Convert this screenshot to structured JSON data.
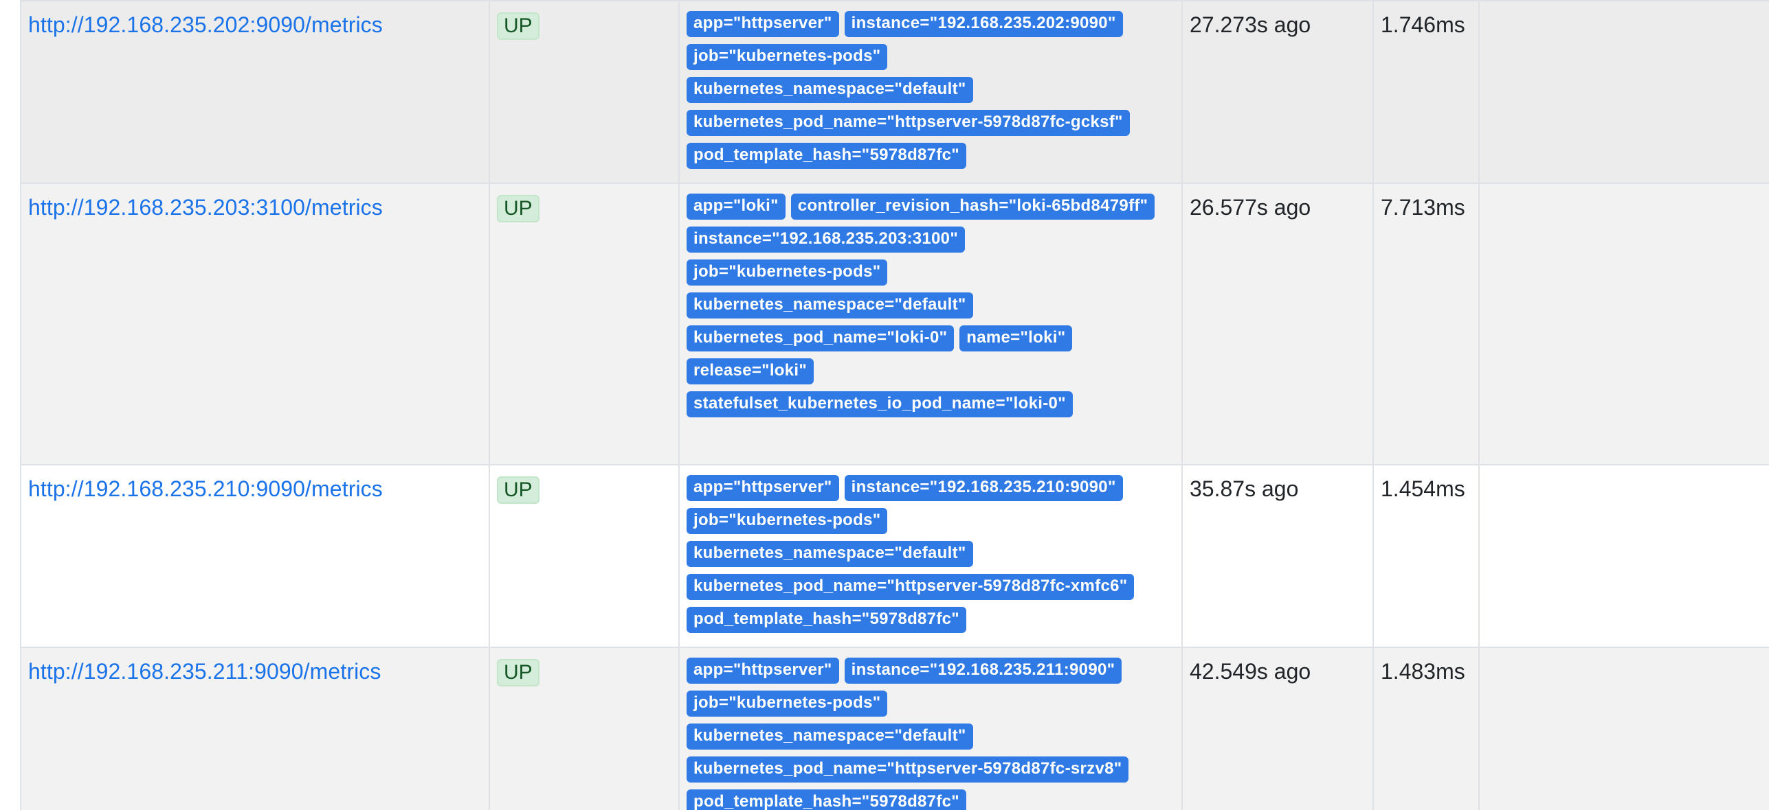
{
  "targets": [
    {
      "endpoint": "http://192.168.235.202:9090/metrics",
      "state": "UP",
      "labels": [
        "app=\"httpserver\"",
        "instance=\"192.168.235.202:9090\"",
        "job=\"kubernetes-pods\"",
        "kubernetes_namespace=\"default\"",
        "kubernetes_pod_name=\"httpserver-5978d87fc-gcksf\"",
        "pod_template_hash=\"5978d87fc\""
      ],
      "last_scrape": "27.273s ago",
      "scrape_duration": "1.746ms",
      "error": ""
    },
    {
      "endpoint": "http://192.168.235.203:3100/metrics",
      "state": "UP",
      "labels": [
        "app=\"loki\"",
        "controller_revision_hash=\"loki-65bd8479ff\"",
        "instance=\"192.168.235.203:3100\"",
        "job=\"kubernetes-pods\"",
        "kubernetes_namespace=\"default\"",
        "kubernetes_pod_name=\"loki-0\"",
        "name=\"loki\"",
        "release=\"loki\"",
        "statefulset_kubernetes_io_pod_name=\"loki-0\""
      ],
      "last_scrape": "26.577s ago",
      "scrape_duration": "7.713ms",
      "error": ""
    },
    {
      "endpoint": "http://192.168.235.210:9090/metrics",
      "state": "UP",
      "labels": [
        "app=\"httpserver\"",
        "instance=\"192.168.235.210:9090\"",
        "job=\"kubernetes-pods\"",
        "kubernetes_namespace=\"default\"",
        "kubernetes_pod_name=\"httpserver-5978d87fc-xmfc6\"",
        "pod_template_hash=\"5978d87fc\""
      ],
      "last_scrape": "35.87s ago",
      "scrape_duration": "1.454ms",
      "error": ""
    },
    {
      "endpoint": "http://192.168.235.211:9090/metrics",
      "state": "UP",
      "labels": [
        "app=\"httpserver\"",
        "instance=\"192.168.235.211:9090\"",
        "job=\"kubernetes-pods\"",
        "kubernetes_namespace=\"default\"",
        "kubernetes_pod_name=\"httpserver-5978d87fc-srzv8\"",
        "pod_template_hash=\"5978d87fc\""
      ],
      "last_scrape": "42.549s ago",
      "scrape_duration": "1.483ms",
      "error": ""
    }
  ],
  "colors": {
    "link": "#1a73e8",
    "label_badge_bg": "#2f7ae5",
    "up_badge_bg": "#d4edda",
    "up_badge_text": "#155724",
    "row_shaded": "#f2f2f2",
    "row_plain": "#ffffff",
    "border": "#dee2e6"
  }
}
